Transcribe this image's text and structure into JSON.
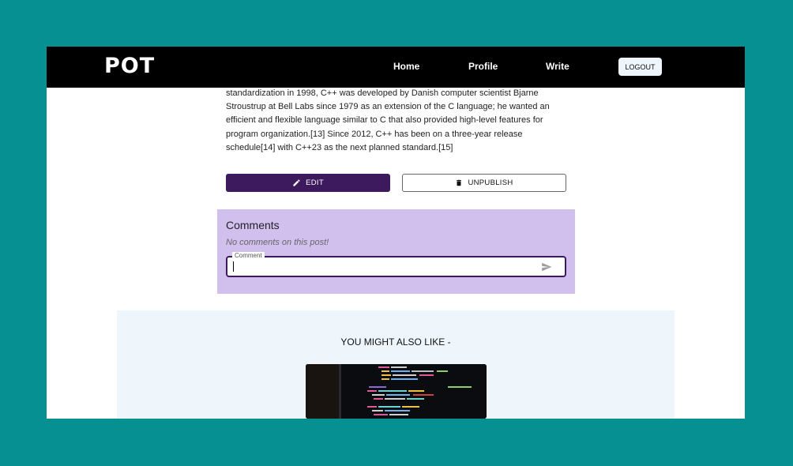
{
  "navbar": {
    "logo": "POT",
    "links": [
      "Home",
      "Profile",
      "Write"
    ],
    "logout_label": "LOGOUT"
  },
  "article": {
    "lines": [
      "standardization in 1998, C++ was developed by Danish computer scientist Bjarne",
      "Stroustrup at Bell Labs since 1979 as an extension of the C language; he wanted an",
      "efficient and flexible language similar to C that also provided high-level features for",
      "program organization.[13] Since 2012, C++ has been on a three-year release",
      "schedule[14] with C++23 as the next planned standard.[15]"
    ]
  },
  "actions": {
    "edit_label": "EDIT",
    "unpublish_label": "UNPUBLISH"
  },
  "comments": {
    "title": "Comments",
    "empty_text": "No comments on this post!",
    "input_label": "Comment",
    "input_value": ""
  },
  "suggestions": {
    "title": "YOU MIGHT ALSO LIKE -"
  },
  "colors": {
    "backdrop": "#079092",
    "navbar": "#000000",
    "primary": "#3d1a5e",
    "comments_bg": "#d1bfee",
    "suggest_bg": "#eef6fc"
  }
}
